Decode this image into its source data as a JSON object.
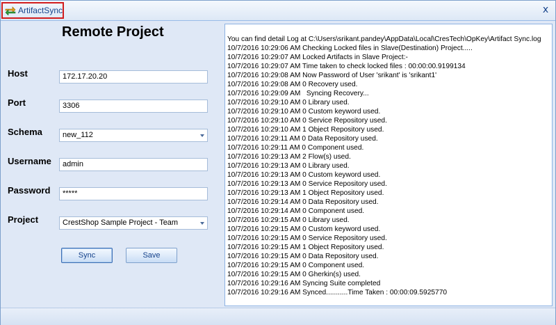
{
  "window": {
    "title": "ArtifactSync",
    "close_symbol": "x",
    "icon": "sync-arrows-icon"
  },
  "form": {
    "heading": "Remote Project",
    "fields": {
      "host": {
        "label": "Host",
        "value": "172.17.20.20"
      },
      "port": {
        "label": "Port",
        "value": "3306"
      },
      "schema": {
        "label": "Schema",
        "value": "new_112"
      },
      "username": {
        "label": "Username",
        "value": "admin"
      },
      "password": {
        "label": "Password",
        "value": "*****"
      },
      "project": {
        "label": "Project",
        "value": "CrestShop Sample Project - Team"
      }
    },
    "sync_label": "Sync",
    "save_label": "Save"
  },
  "log": {
    "lines": [
      "You can find detail Log at C:\\Users\\srikant.pandey\\AppData\\Local\\CresTech\\OpKey\\Artifact Sync.log",
      "10/7/2016 10:29:06 AM Checking Locked files in Slave(Destination) Project.....",
      "10/7/2016 10:29:07 AM Locked Artifacts in Slave Project:-",
      "10/7/2016 10:29:07 AM Time taken to check locked files : 00:00:00.9199134",
      "10/7/2016 10:29:08 AM Now Password of User 'srikant' is 'srikant1'",
      "10/7/2016 10:29:08 AM 0 Recovery used.",
      "10/7/2016 10:29:09 AM   Syncing Recovery...",
      "10/7/2016 10:29:10 AM 0 Library used.",
      "10/7/2016 10:29:10 AM 0 Custom keyword used.",
      "10/7/2016 10:29:10 AM 0 Service Repository used.",
      "10/7/2016 10:29:10 AM 1 Object Repository used.",
      "10/7/2016 10:29:11 AM 0 Data Repository used.",
      "10/7/2016 10:29:11 AM 0 Component used.",
      "10/7/2016 10:29:13 AM 2 Flow(s) used.",
      "10/7/2016 10:29:13 AM 0 Library used.",
      "10/7/2016 10:29:13 AM 0 Custom keyword used.",
      "10/7/2016 10:29:13 AM 0 Service Repository used.",
      "10/7/2016 10:29:13 AM 1 Object Repository used.",
      "10/7/2016 10:29:14 AM 0 Data Repository used.",
      "10/7/2016 10:29:14 AM 0 Component used.",
      "10/7/2016 10:29:15 AM 0 Library used.",
      "10/7/2016 10:29:15 AM 0 Custom keyword used.",
      "10/7/2016 10:29:15 AM 0 Service Repository used.",
      "10/7/2016 10:29:15 AM 1 Object Repository used.",
      "10/7/2016 10:29:15 AM 0 Data Repository used.",
      "10/7/2016 10:29:15 AM 0 Component used.",
      "10/7/2016 10:29:15 AM 0 Gherkin(s) used.",
      "10/7/2016 10:29:16 AM Syncing Suite completed",
      "10/7/2016 10:29:16 AM Synced...........Time Taken : 00:00:09.5925770"
    ]
  },
  "colors": {
    "title_highlight": "#d11d1d",
    "title_text": "#15428b",
    "window_bg": "#dfe8f6"
  }
}
